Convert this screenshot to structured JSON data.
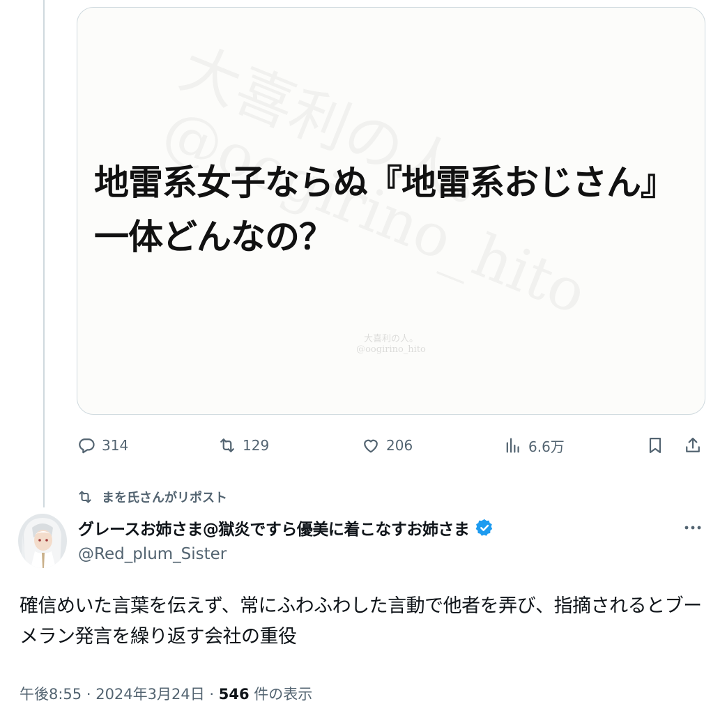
{
  "media": {
    "main_text_line1": "地雷系女子ならぬ『地雷系おじさん』",
    "main_text_line2": "一体どんなの？",
    "watermark_line1": "大喜利の人。",
    "watermark_line2": "@oogirino_hito"
  },
  "actions": {
    "replies": "314",
    "reposts": "129",
    "likes": "206",
    "views": "6.6万"
  },
  "repost_note": "まを氏さんがリポスト",
  "author": {
    "display_name": "グレースお姉さま@獄炎ですら優美に着こなすお姉さま",
    "handle": "@Red_plum_Sister",
    "verified": true
  },
  "tweet": {
    "text": "確信めいた言葉を伝えず、常にふわふわした言動で他者を弄び、指摘されるとブーメラン発言を繰り返す会社の重役"
  },
  "meta": {
    "time": "午後8:55",
    "sep1": " · ",
    "date": "2024年3月24日",
    "sep2": " · ",
    "views_count": "546",
    "views_label": " 件の表示"
  },
  "colors": {
    "secondary_text": "#536471",
    "primary_text": "#0f1419",
    "verified_blue": "#1d9bf0",
    "border": "#cfd9de"
  },
  "icons": [
    "reply-icon",
    "repost-icon",
    "like-icon",
    "views-icon",
    "bookmark-icon",
    "share-icon",
    "verified-icon",
    "more-icon"
  ]
}
